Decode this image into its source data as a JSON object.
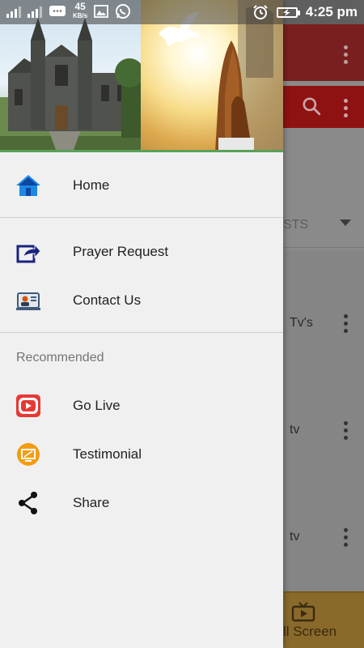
{
  "status_bar": {
    "speed_value": "45",
    "speed_unit": "KB/s",
    "time": "4:25 pm"
  },
  "background": {
    "filter_text": "STS",
    "list_items": [
      "Tv's",
      "tv",
      "tv"
    ],
    "fullscreen_label": "ll Screen"
  },
  "drawer": {
    "menu": [
      {
        "label": "Home",
        "icon": "home-icon"
      },
      {
        "label": "Prayer Request",
        "icon": "share-arrow-icon"
      },
      {
        "label": "Contact Us",
        "icon": "contact-icon"
      }
    ],
    "section_title": "Recommended",
    "recommended": [
      {
        "label": "Go Live",
        "icon": "youtube-icon"
      },
      {
        "label": "Testimonial",
        "icon": "tv-icon"
      },
      {
        "label": "Share",
        "icon": "share-icon"
      }
    ]
  },
  "colors": {
    "drawer_bg": "#f0f0f0",
    "header_border": "#58a158",
    "toolbar": "#7a1f1f",
    "home_blue": "#1e88e5",
    "youtube_red": "#e53935",
    "testimonial_orange": "#f39c12"
  }
}
